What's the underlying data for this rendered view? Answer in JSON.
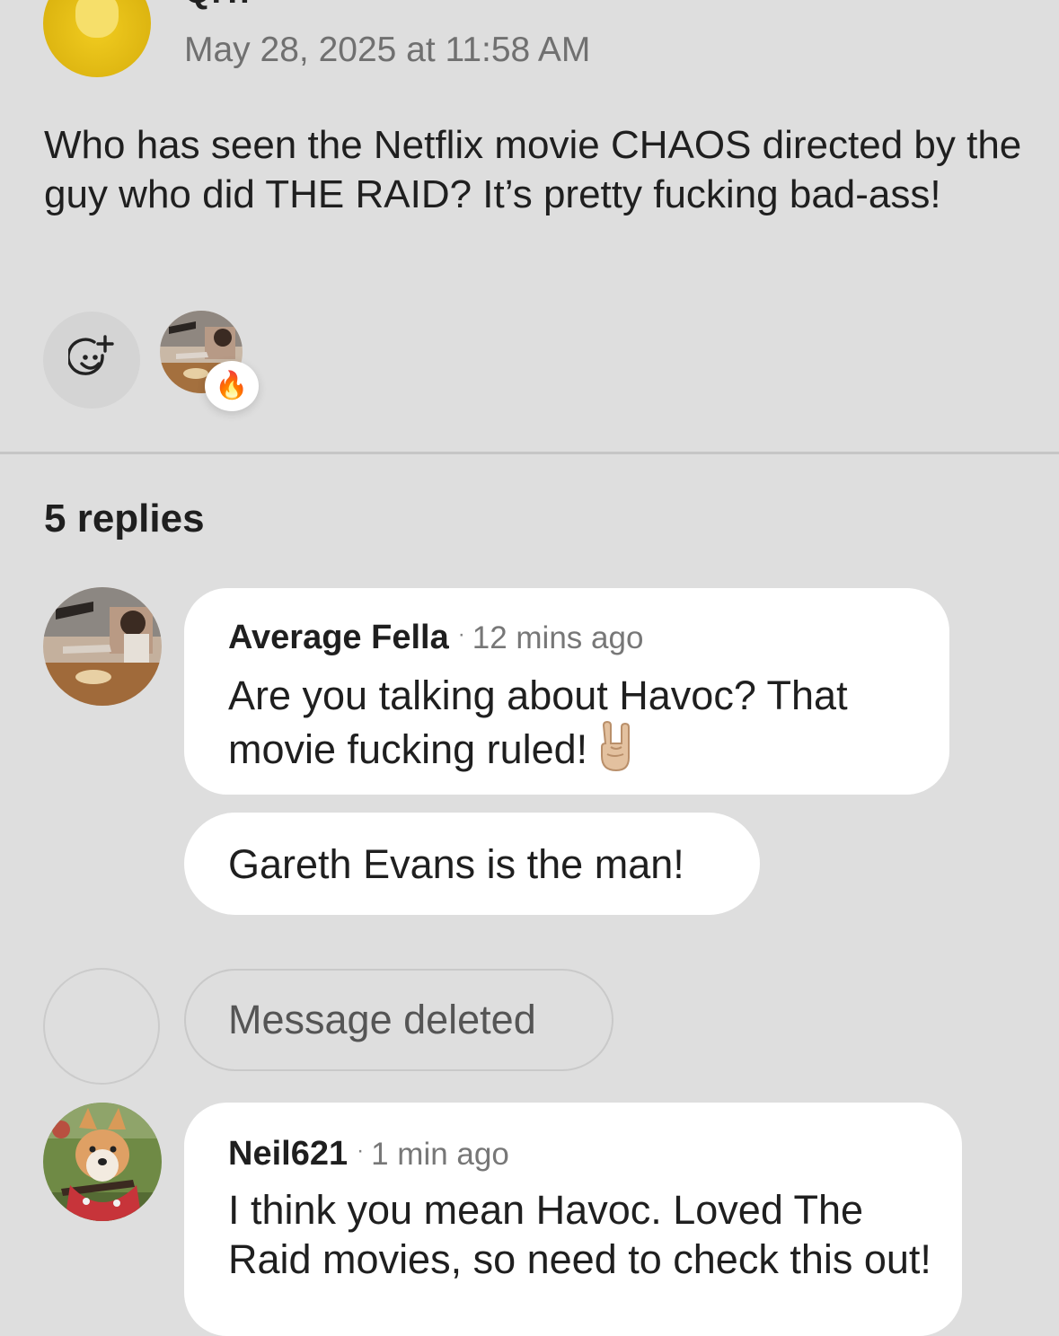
{
  "post": {
    "author": "Q.T.",
    "timestamp": "May 28, 2025 at 11:58 AM",
    "body": "Who has seen the Netflix movie CHAOS directed by the guy who did THE RAID? It’s pretty fucking bad-ass!",
    "add_reaction_icon": "smiley-plus-icon",
    "reaction": {
      "emoji": "🔥",
      "icon": "fire-icon"
    }
  },
  "replies_count": "5 replies",
  "replies": [
    {
      "author": "Average Fella",
      "separator": "·",
      "time": "12 mins ago",
      "text": "Are you talking about Havoc? That movie fucking ruled!",
      "emoji_icon": "rock-on-hand-icon"
    },
    {
      "text": "Gareth Evans is the man!"
    },
    {
      "text": "Message deleted"
    },
    {
      "author": "Neil621",
      "separator": "·",
      "time": "1 min ago",
      "text": "I think you mean Havoc. Loved The Raid movies, so need to check this out!"
    }
  ],
  "colors": {
    "background": "#dedede",
    "bubble": "#ffffff",
    "post_avatar": "#dcb410",
    "muted_text": "#707070"
  }
}
